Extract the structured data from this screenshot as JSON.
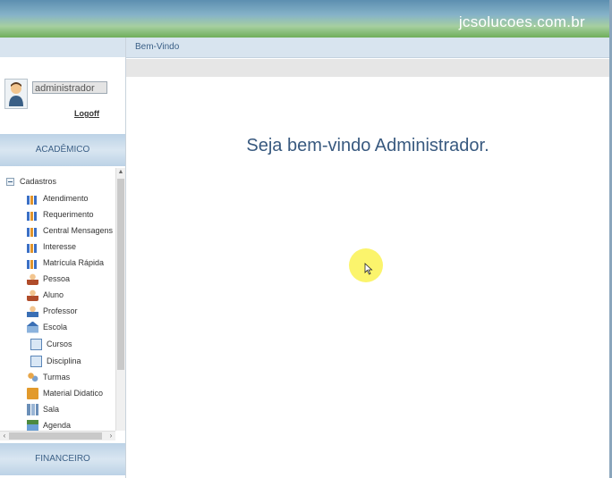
{
  "header": {
    "site_name": "jcsolucoes.com.br"
  },
  "main": {
    "tab_label": "Bem-Vindo",
    "welcome_text": "Seja bem-vindo Administrador."
  },
  "user": {
    "username": "administrador",
    "logoff_label": "Logoff"
  },
  "sidebar": {
    "sections": [
      {
        "label": "ACADÊMICO"
      },
      {
        "label": "FINANCEIRO"
      }
    ],
    "tree": {
      "root_label": "Cadastros",
      "items": [
        {
          "label": "Atendimento",
          "icon": "chart-icon"
        },
        {
          "label": "Requerimento",
          "icon": "chart-icon"
        },
        {
          "label": "Central Mensagens",
          "icon": "chart-icon"
        },
        {
          "label": "Interesse",
          "icon": "chart-icon"
        },
        {
          "label": "Matrícula Rápida",
          "icon": "chart-icon"
        },
        {
          "label": "Pessoa",
          "icon": "person-icon"
        },
        {
          "label": "Aluno",
          "icon": "student-icon"
        },
        {
          "label": "Professor",
          "icon": "teacher-icon"
        },
        {
          "label": "Escola",
          "icon": "school-icon"
        },
        {
          "label": "Cursos",
          "icon": "document-icon"
        },
        {
          "label": "Disciplina",
          "icon": "document-icon"
        },
        {
          "label": "Turmas",
          "icon": "group-icon"
        },
        {
          "label": "Material Didatico",
          "icon": "material-icon"
        },
        {
          "label": "Sala",
          "icon": "room-icon"
        },
        {
          "label": "Agenda",
          "icon": "calendar-icon"
        }
      ]
    }
  },
  "colors": {
    "accent": "#3a5f86",
    "header_green": "#6fae5b",
    "header_blue": "#5d8fb0"
  }
}
